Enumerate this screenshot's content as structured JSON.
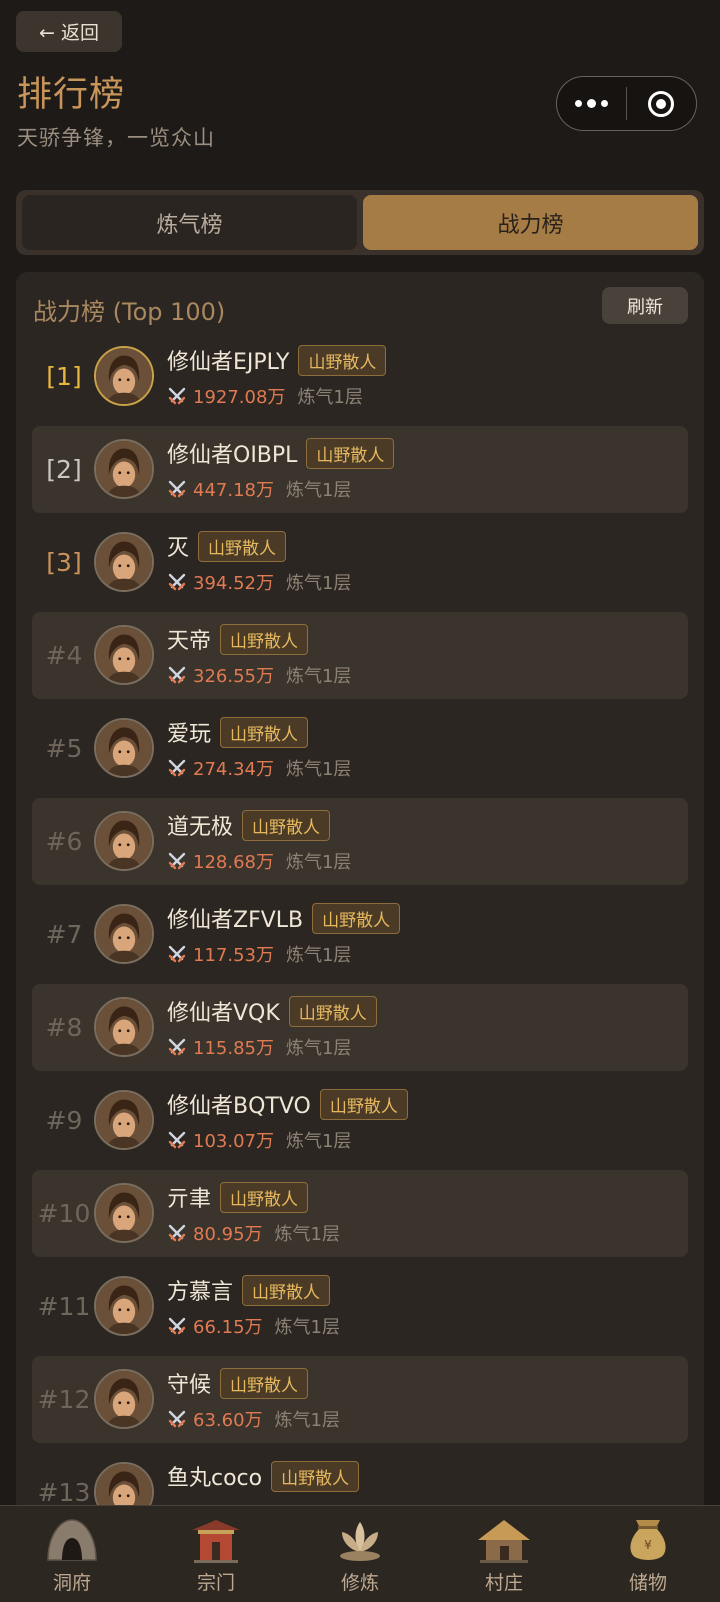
{
  "header": {
    "back_label": "← 返回",
    "title": "排行榜",
    "subtitle": "天骄争锋，一览众山"
  },
  "capsule": {
    "more_icon": "more-dots-icon",
    "close_icon": "target-circle-icon"
  },
  "tabs": [
    {
      "label": "炼气榜",
      "active": false
    },
    {
      "label": "战力榜",
      "active": true
    }
  ],
  "panel": {
    "title": "战力榜 (Top 100)",
    "refresh_label": "刷新"
  },
  "rankings": [
    {
      "rank": "[1]",
      "name": "修仙者EJPLY",
      "badge": "山野散人",
      "power": "1927.08万",
      "realm": "炼气1层"
    },
    {
      "rank": "[2]",
      "name": "修仙者OIBPL",
      "badge": "山野散人",
      "power": "447.18万",
      "realm": "炼气1层"
    },
    {
      "rank": "[3]",
      "name": "灭",
      "badge": "山野散人",
      "power": "394.52万",
      "realm": "炼气1层"
    },
    {
      "rank": "#4",
      "name": "天帝",
      "badge": "山野散人",
      "power": "326.55万",
      "realm": "炼气1层"
    },
    {
      "rank": "#5",
      "name": "爱玩",
      "badge": "山野散人",
      "power": "274.34万",
      "realm": "炼气1层"
    },
    {
      "rank": "#6",
      "name": "道无极",
      "badge": "山野散人",
      "power": "128.68万",
      "realm": "炼气1层"
    },
    {
      "rank": "#7",
      "name": "修仙者ZFVLB",
      "badge": "山野散人",
      "power": "117.53万",
      "realm": "炼气1层"
    },
    {
      "rank": "#8",
      "name": "修仙者VQK",
      "badge": "山野散人",
      "power": "115.85万",
      "realm": "炼气1层"
    },
    {
      "rank": "#9",
      "name": "修仙者BQTVO",
      "badge": "山野散人",
      "power": "103.07万",
      "realm": "炼气1层"
    },
    {
      "rank": "#10",
      "name": "亓聿",
      "badge": "山野散人",
      "power": "80.95万",
      "realm": "炼气1层"
    },
    {
      "rank": "#11",
      "name": "方慕言",
      "badge": "山野散人",
      "power": "66.15万",
      "realm": "炼气1层"
    },
    {
      "rank": "#12",
      "name": "守候",
      "badge": "山野散人",
      "power": "63.60万",
      "realm": "炼气1层"
    },
    {
      "rank": "#13",
      "name": "鱼丸coco",
      "badge": "山野散人",
      "power": "",
      "realm": ""
    }
  ],
  "bottom_nav": [
    {
      "label": "洞府",
      "icon": "cave-icon"
    },
    {
      "label": "宗门",
      "icon": "sect-gate-icon"
    },
    {
      "label": "修炼",
      "icon": "lotus-icon"
    },
    {
      "label": "村庄",
      "icon": "village-hut-icon"
    },
    {
      "label": "储物",
      "icon": "storage-bag-icon"
    }
  ],
  "colors": {
    "accent": "#a57c45",
    "power": "#e07a52",
    "badge": "#e5b860",
    "background": "#1e1a17"
  }
}
